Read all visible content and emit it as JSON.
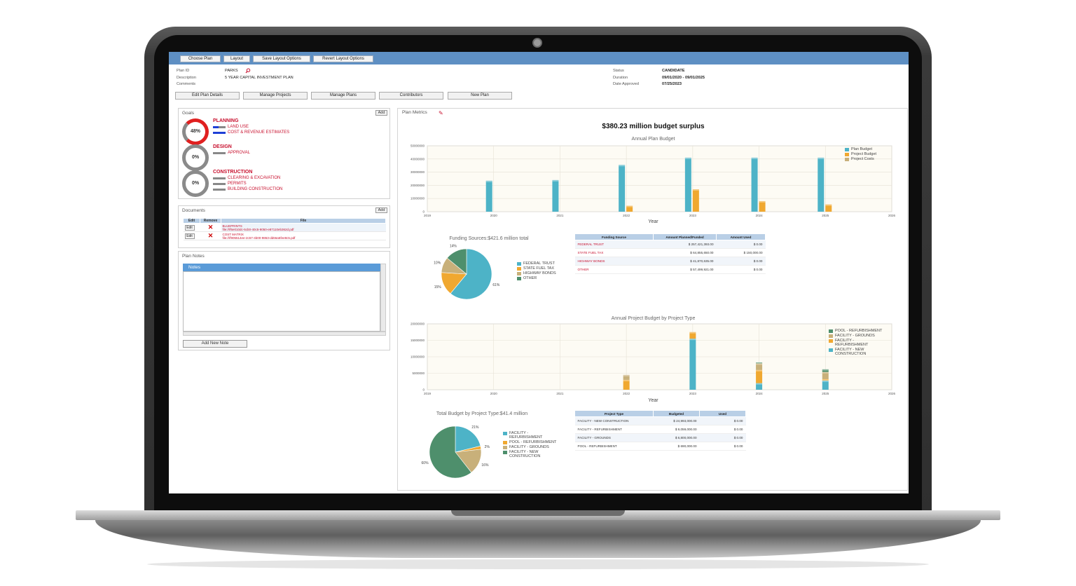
{
  "toolbar": {
    "choose_plan": "Choose Plan",
    "layout": "Layout",
    "save_layout": "Save Layout Options",
    "revert_layout": "Revert Layout Options"
  },
  "plan_info": {
    "plan_id_label": "Plan ID",
    "plan_id": "PARKS",
    "description_label": "Description",
    "description": "5 YEAR CAPITAL INVESTMENT PLAN",
    "comments_label": "Comments",
    "status_label": "Status",
    "status": "CANDIDATE",
    "duration_label": "Duration",
    "duration": "09/01/2020 - 09/01/2025",
    "date_approved_label": "Date Approved",
    "date_approved": "07/25/2023"
  },
  "actions": {
    "edit_plan_details": "Edit Plan Details",
    "manage_projects": "Manage Projects",
    "manage_plans": "Manage Plans",
    "contributors": "Contributors",
    "new_plan": "New Plan"
  },
  "goals": {
    "title": "Goals",
    "add": "Add",
    "groups": [
      {
        "name": "PLANNING",
        "pct": "48%",
        "progress": 0.48,
        "items": [
          "LAND USE",
          "COST & REVENUE ESTIMATES"
        ]
      },
      {
        "name": "DESIGN",
        "pct": "0%",
        "progress": 0,
        "items": [
          "APPROVAL"
        ]
      },
      {
        "name": "CONSTRUCTION",
        "pct": "0%",
        "progress": 0,
        "items": [
          "CLEARING & EXCAVATION",
          "PERMITS",
          "BUILDING CONSTRUCTION"
        ]
      }
    ]
  },
  "documents": {
    "title": "Documents",
    "add": "Add",
    "headers": [
      "Edit",
      "Remove",
      "File"
    ],
    "edit_label": "Edit",
    "rows": [
      {
        "name": "BLUEPRINTS",
        "path": "file:///f6e010dc-5cb0-40c5-9050-e87110eb362d.pdf"
      },
      {
        "name": "COST MATRIX",
        "path": "file:///f905514ee-2c57-4b00-9863-dd66a5fee8c5.pdf"
      }
    ]
  },
  "plan_notes": {
    "title": "Plan Notes",
    "notes_header": "Notes",
    "add_note": "Add New Note"
  },
  "metrics": {
    "title": "Plan Metrics",
    "headline": "$380.23 million budget surplus"
  },
  "chart_data": [
    {
      "type": "bar",
      "title": "Annual Plan Budget",
      "xlabel": "Year",
      "ylabel": "",
      "ylim": [
        0,
        50000000
      ],
      "yticks": [
        "50000000",
        "40000000",
        "30000000",
        "20000000",
        "10000000",
        "0"
      ],
      "xticks": [
        "2019",
        "2020",
        "2021",
        "2022",
        "2023",
        "2024",
        "2025",
        "2026"
      ],
      "categories": [
        "2020",
        "2021",
        "2022",
        "2023",
        "2024",
        "2025"
      ],
      "series": [
        {
          "name": "Plan Budget",
          "color": "#4db3c7",
          "values": [
            23500000,
            24000000,
            35500000,
            41000000,
            41000000,
            41000000
          ]
        },
        {
          "name": "Project Budget",
          "color": "#f0a830",
          "values": [
            0,
            0,
            4500000,
            17000000,
            8000000,
            5500000
          ]
        },
        {
          "name": "Project Costs",
          "color": "#c8b07a",
          "values": [
            0,
            0,
            0,
            0,
            0,
            0
          ]
        }
      ],
      "legend": "top-right"
    },
    {
      "type": "pie",
      "title": "Funding Sources:$421.6 million total",
      "labels": [
        "FEDERAL TRUST",
        "STATE FUEL TAX",
        "HIGHWAY BONDS",
        "OTHER"
      ],
      "values": [
        61,
        15,
        10,
        14
      ],
      "value_labels": [
        "61%",
        "15%",
        "10%",
        "14%"
      ],
      "colors": [
        "#4db3c7",
        "#f0a830",
        "#c8b07a",
        "#4e8f6c"
      ]
    },
    {
      "type": "table",
      "headers": [
        "Funding Source",
        "Amount Planned/Funded",
        "Amount Used"
      ],
      "rows": [
        [
          "FEDERAL TRUST",
          "$ 257,421,393.00",
          "$ 0.00"
        ],
        [
          "STATE FUEL TAX",
          "$ 64,855,650.00",
          "$ 150,000.00"
        ],
        [
          "HIGHWAY BONDS",
          "$ 41,870,635.00",
          "$ 0.00"
        ],
        [
          "OTHER",
          "$ 57,499,921.00",
          "$ 0.00"
        ]
      ]
    },
    {
      "type": "bar",
      "stacked": true,
      "title": "Annual Project Budget by Project Type",
      "xlabel": "Year",
      "ylabel": "",
      "ylim": [
        0,
        20000000
      ],
      "yticks": [
        "20000000",
        "15000000",
        "10000000",
        "5000000",
        "0"
      ],
      "xticks": [
        "2019",
        "2020",
        "2021",
        "2022",
        "2023",
        "2024",
        "2025",
        "2026"
      ],
      "categories": [
        "2022",
        "2023",
        "2024",
        "2025"
      ],
      "series": [
        {
          "name": "FACILITY - NEW CONSTRUCTION",
          "color": "#4db3c7",
          "values": [
            0,
            15500000,
            2000000,
            2800000
          ]
        },
        {
          "name": "FACILITY - REFURBISHMENT",
          "color": "#f0a830",
          "values": [
            3000000,
            2000000,
            4000000,
            400000
          ]
        },
        {
          "name": "FACILITY - GROUNDS",
          "color": "#c8b07a",
          "values": [
            1500000,
            0,
            2000000,
            2200000
          ]
        },
        {
          "name": "POOL - REFURBISHMENT",
          "color": "#4e8f6c",
          "values": [
            0,
            0,
            300000,
            800000
          ]
        }
      ],
      "legend": "top-right"
    },
    {
      "type": "pie",
      "title": "Total Budget by Project Type:$41.4 million",
      "labels": [
        "FACILITY - REFURBISHMENT",
        "POOL - REFURBISHMENT",
        "FACILITY - GROUNDS",
        "FACILITY - NEW CONSTRUCTION"
      ],
      "values": [
        21,
        2,
        16,
        60
      ],
      "value_labels": [
        "21%",
        "2%",
        "16%",
        "60%"
      ],
      "colors": [
        "#4db3c7",
        "#f0a830",
        "#c8b07a",
        "#4e8f6c"
      ]
    },
    {
      "type": "table",
      "headers": [
        "Project Type",
        "Budgeted",
        "Used"
      ],
      "rows": [
        [
          "FACILITY - NEW CONSTRUCTION",
          "$ 24,993,000.00",
          "$ 0.00"
        ],
        [
          "FACILITY - REFURBISHMENT",
          "$ 9,059,000.00",
          "$ 0.00"
        ],
        [
          "FACILITY - GROUNDS",
          "$ 6,800,000.00",
          "$ 0.00"
        ],
        [
          "POOL - REFURBISHMENT",
          "$ 690,000.00",
          "$ 0.00"
        ]
      ]
    }
  ]
}
